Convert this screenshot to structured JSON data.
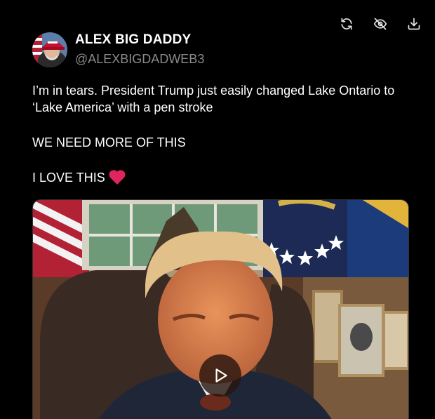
{
  "toolbar": {
    "refresh_icon": "refresh-icon",
    "hide_icon": "eye-off-icon",
    "download_icon": "download-icon"
  },
  "post": {
    "author": {
      "display_name": "ALEX BIG DADDY",
      "handle": "@ALEXBIGDADWEB3"
    },
    "text_line1": "I’m in tears. President Trump just easily changed Lake Ontario to ‘Lake America’ with a pen stroke",
    "text_line2": "WE NEED MORE OF THIS",
    "text_line3": "I LOVE THIS",
    "emoji": "heart-icon",
    "media": {
      "type": "video",
      "play_icon": "play-icon"
    }
  },
  "colors": {
    "background": "#000000",
    "text": "#ffffff",
    "handle": "#8a8a8a",
    "heart": "#e0245e"
  }
}
